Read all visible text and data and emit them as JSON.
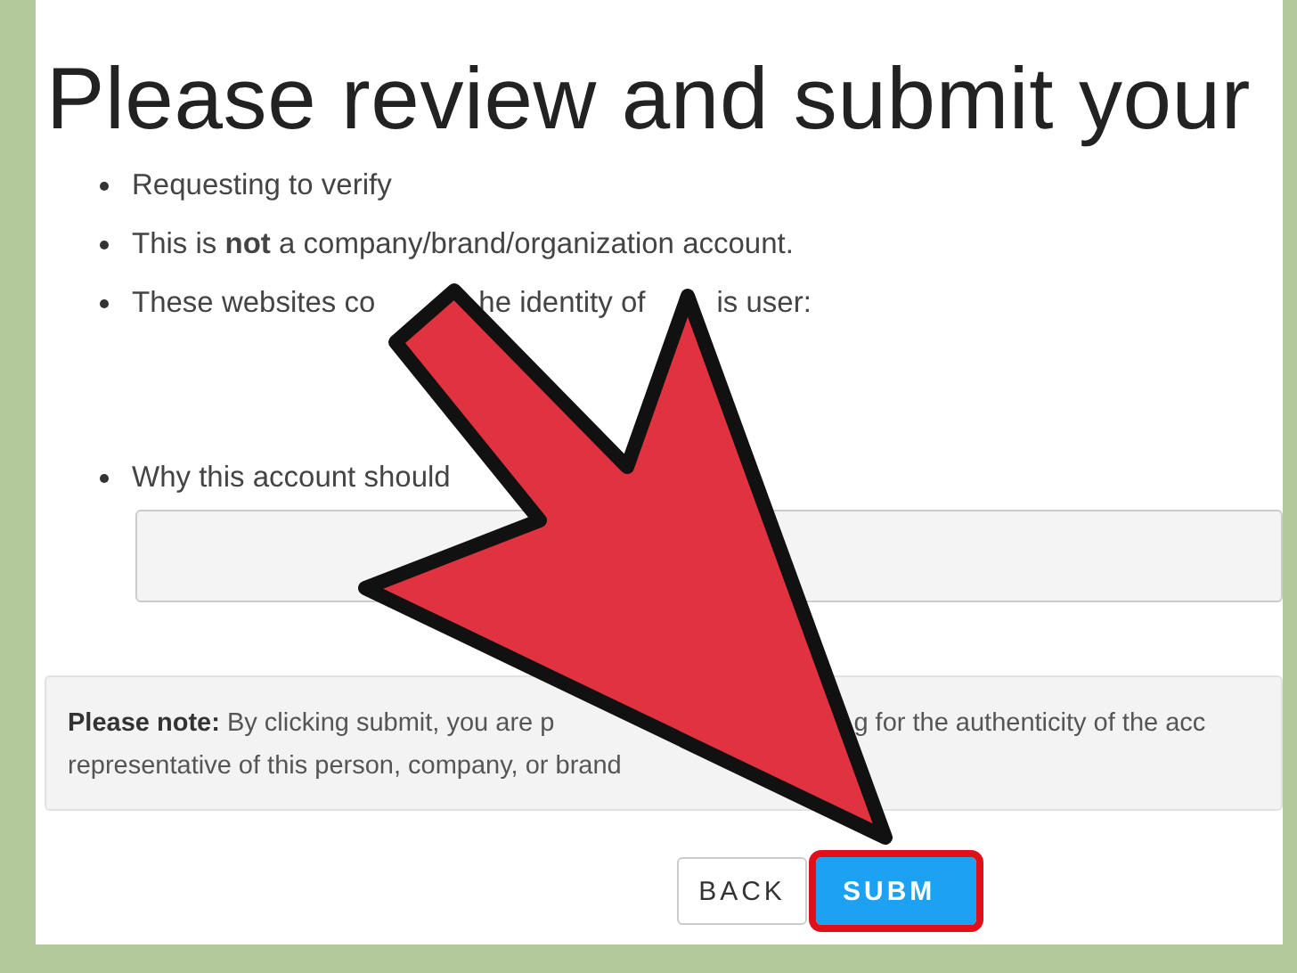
{
  "title": "Please review and submit your",
  "items": [
    {
      "segments": [
        "Requesting to verify"
      ],
      "has_field": false
    },
    {
      "segments": [
        "This is **not** a company/brand/organization account."
      ],
      "has_field": false
    },
    {
      "segments": [
        "These websites co",
        "he identity of",
        "is user:"
      ],
      "has_field": false
    },
    {
      "segments": [
        "Why this account should"
      ],
      "has_field": true
    }
  ],
  "note_lines": [
    [
      "**Please note:** By clicking submit, you are p",
      "g for the authenticity of the acc"
    ],
    [
      "representative of this person, company, or brand"
    ]
  ],
  "buttons": [
    {
      "label": "BACK",
      "kind": "secondary",
      "highlighted": false
    },
    {
      "label": "SUBM",
      "kind": "primary",
      "highlighted": true
    }
  ]
}
